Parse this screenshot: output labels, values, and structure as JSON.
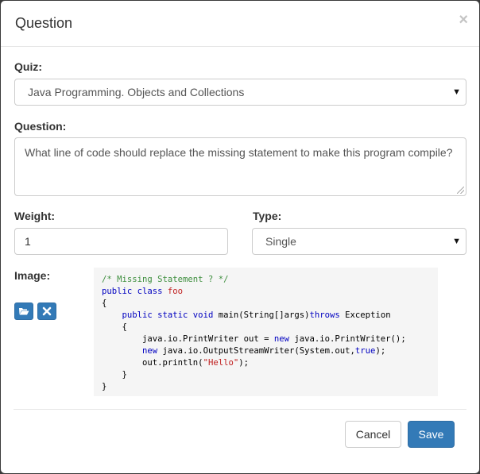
{
  "modal": {
    "title": "Question",
    "close_glyph": "×"
  },
  "form": {
    "quiz": {
      "label": "Quiz:",
      "selected": "Java Programming. Objects and Collections"
    },
    "question": {
      "label": "Question:",
      "value": "What line of code should replace the missing statement to make this program compile?"
    },
    "weight": {
      "label": "Weight:",
      "value": "1"
    },
    "type": {
      "label": "Type:",
      "selected": "Single"
    },
    "image": {
      "label": "Image:",
      "open_icon": "folder-open-icon",
      "remove_icon": "remove-icon",
      "code_lines": [
        [
          {
            "t": "/* Missing Statement ? */",
            "c": "comment"
          }
        ],
        [
          {
            "t": "public class ",
            "c": "kw"
          },
          {
            "t": "foo",
            "c": "cls"
          }
        ],
        [
          {
            "t": "{",
            "c": ""
          }
        ],
        [
          {
            "t": "    ",
            "c": ""
          },
          {
            "t": "public static void ",
            "c": "kw"
          },
          {
            "t": "main(String[]args)",
            "c": ""
          },
          {
            "t": "throws",
            "c": "kw"
          },
          {
            "t": " Exception",
            "c": ""
          }
        ],
        [
          {
            "t": "    {",
            "c": ""
          }
        ],
        [
          {
            "t": "        java.io.PrintWriter out = ",
            "c": ""
          },
          {
            "t": "new",
            "c": "kw"
          },
          {
            "t": " java.io.PrintWriter();",
            "c": ""
          }
        ],
        [
          {
            "t": "        ",
            "c": ""
          },
          {
            "t": "new",
            "c": "kw"
          },
          {
            "t": " java.io.OutputStreamWriter(System.out,",
            "c": ""
          },
          {
            "t": "true",
            "c": "kw"
          },
          {
            "t": ");",
            "c": ""
          }
        ],
        [
          {
            "t": "        out.println(",
            "c": ""
          },
          {
            "t": "\"Hello\"",
            "c": "str"
          },
          {
            "t": ");",
            "c": ""
          }
        ],
        [
          {
            "t": "    }",
            "c": ""
          }
        ],
        [
          {
            "t": "}",
            "c": ""
          }
        ]
      ]
    }
  },
  "footer": {
    "cancel_label": "Cancel",
    "save_label": "Save"
  },
  "colors": {
    "primary": "#337ab7",
    "comment": "#3f8f3f",
    "keyword": "#0000c0",
    "string": "#c02020"
  }
}
